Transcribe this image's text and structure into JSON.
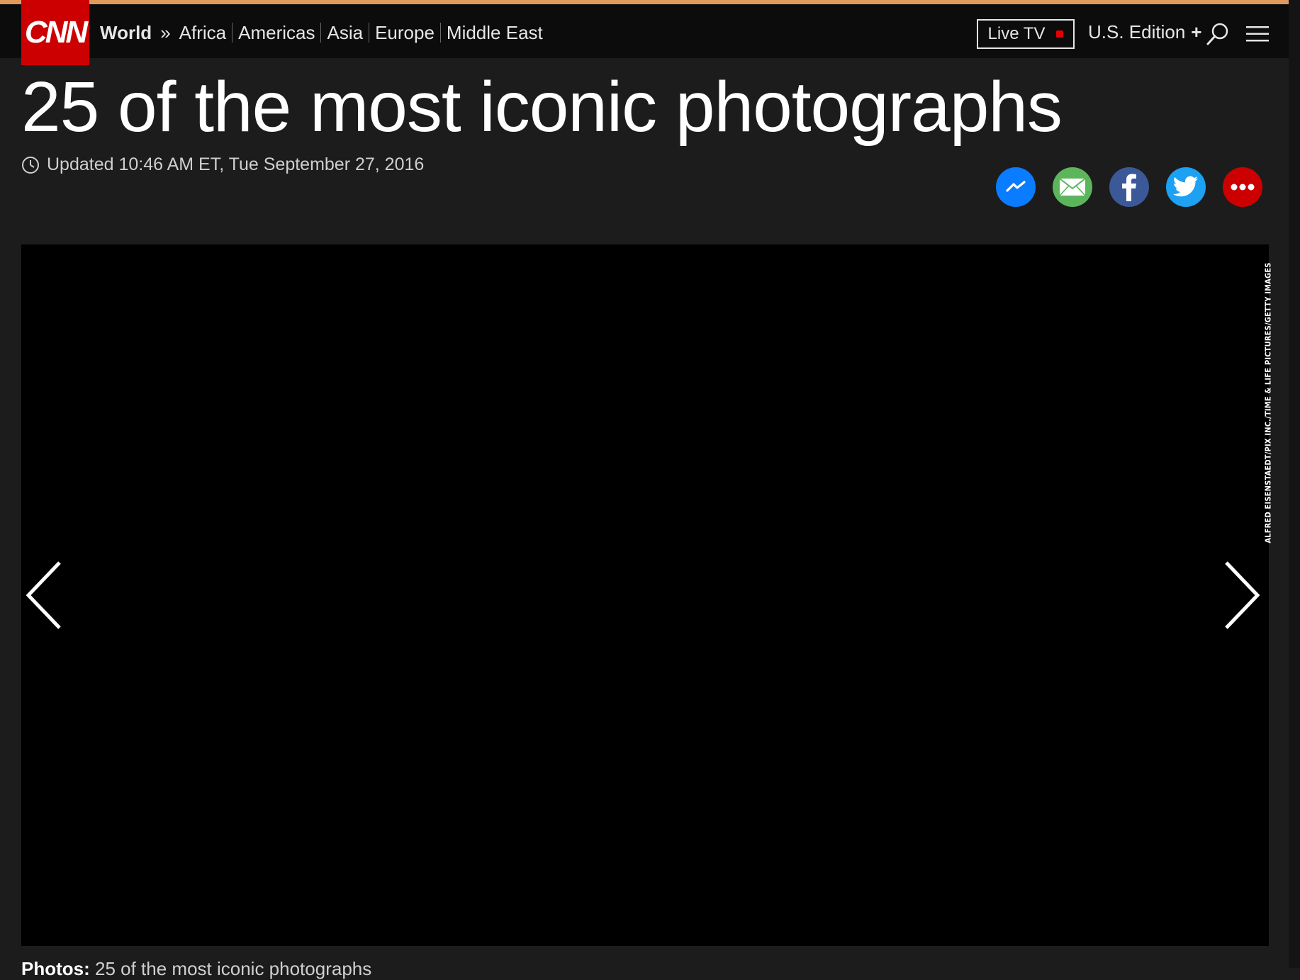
{
  "nav": {
    "logo": "CNN",
    "section": "World",
    "breadcrumb_sep": "»",
    "subsections": [
      "Africa",
      "Americas",
      "Asia",
      "Europe",
      "Middle East"
    ],
    "live_tv_label": "Live TV",
    "edition_label": "U.S. Edition",
    "edition_plus": "+"
  },
  "article": {
    "headline": "25 of the most iconic photographs",
    "updated": "Updated 10:46 AM ET, Tue September 27, 2016"
  },
  "share": {
    "icons": [
      "messenger-icon",
      "email-icon",
      "facebook-icon",
      "twitter-icon",
      "more-icon"
    ],
    "colors": {
      "messenger": "#0a7cff",
      "email": "#5cb55b",
      "facebook": "#3b5998",
      "twitter": "#1da1f2",
      "more": "#cc0000"
    }
  },
  "gallery": {
    "credit": "ALFRED EISENSTAEDT/PIX INC./TIME & LIFE PICTURES/GETTY IMAGES",
    "caption_label": "Photos:",
    "caption_text": "25 of the most iconic photographs"
  },
  "theme": {
    "brand_red": "#cc0000",
    "accent_bar": "#e09a5e",
    "background": "#1c1c1c"
  }
}
